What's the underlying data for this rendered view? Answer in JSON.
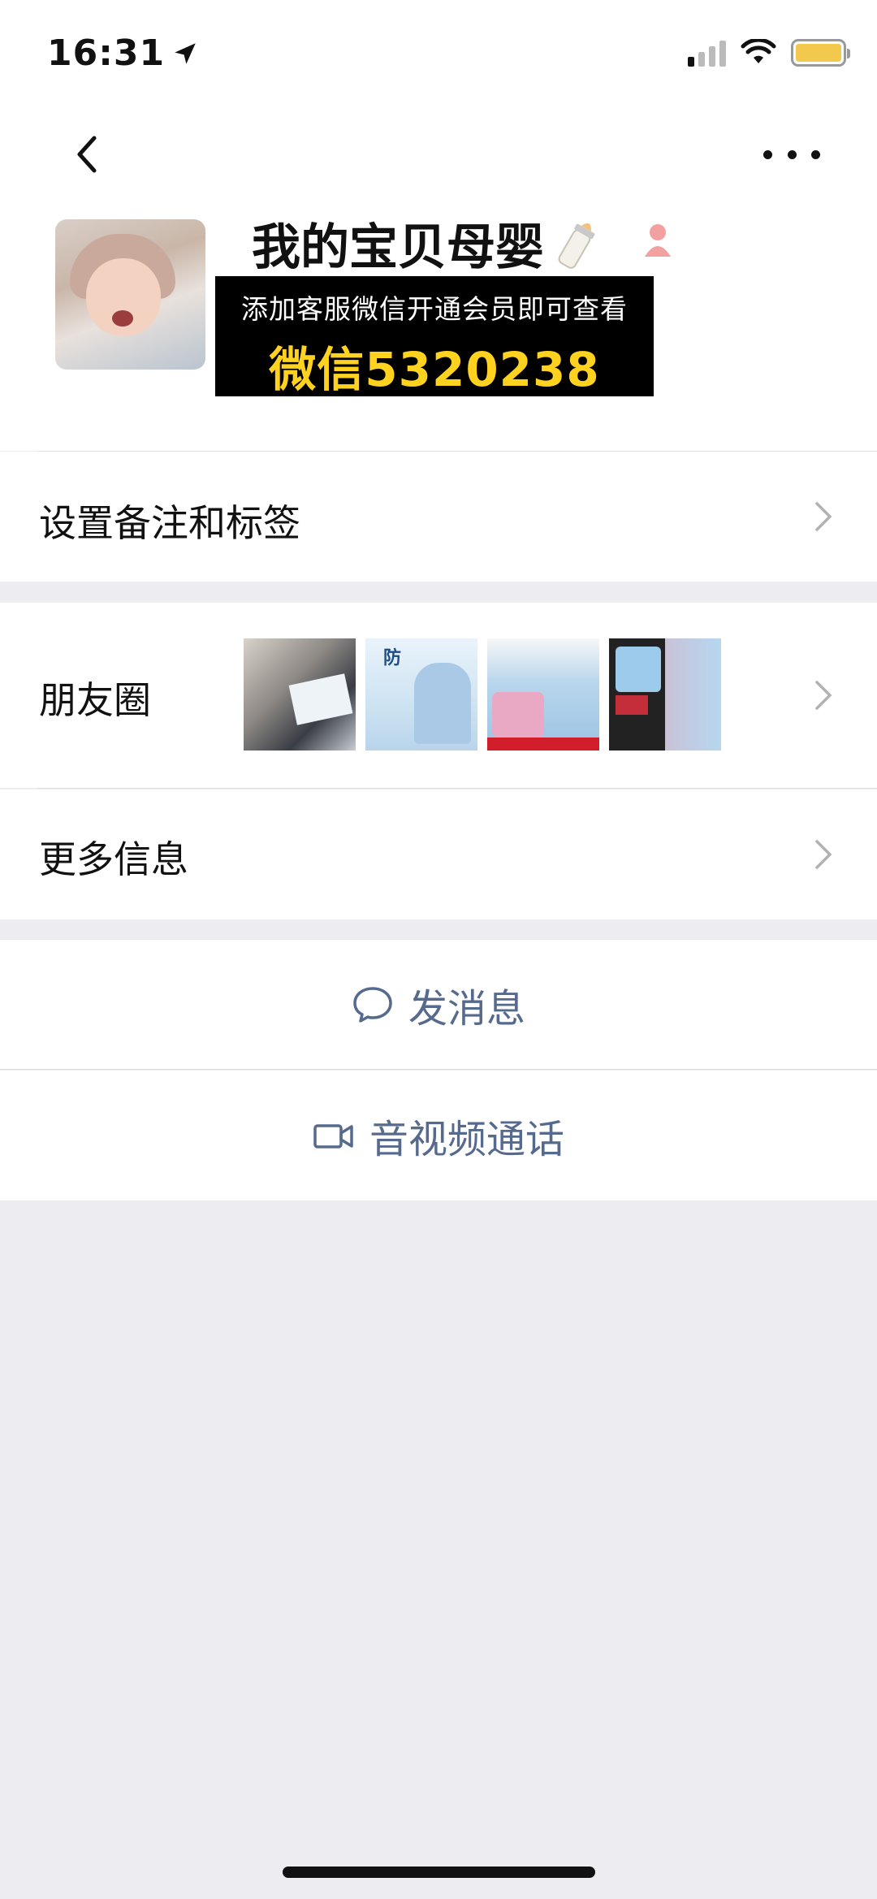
{
  "status_bar": {
    "time": "16:31",
    "battery_color": "#f2c94c"
  },
  "nav": {
    "back_icon": "chevron-left-icon",
    "more_icon": "ellipsis-icon"
  },
  "profile": {
    "nickname": "我的宝贝母婴",
    "nickname_emoji": "baby-bottle-icon",
    "gender_icon": "female-user-icon",
    "promo_line1": "添加客服微信开通会员即可查看",
    "promo_line2": "微信5320238"
  },
  "rows": {
    "remark": "设置备注和标签",
    "moments": "朋友圈",
    "moments_thumb_2_text": "防",
    "more_info": "更多信息"
  },
  "actions": {
    "message": "发消息",
    "call": "音视频通话"
  },
  "colors": {
    "link_blue": "#566a8e",
    "promo_yellow": "#ffd21f",
    "background": "#ededf1"
  }
}
